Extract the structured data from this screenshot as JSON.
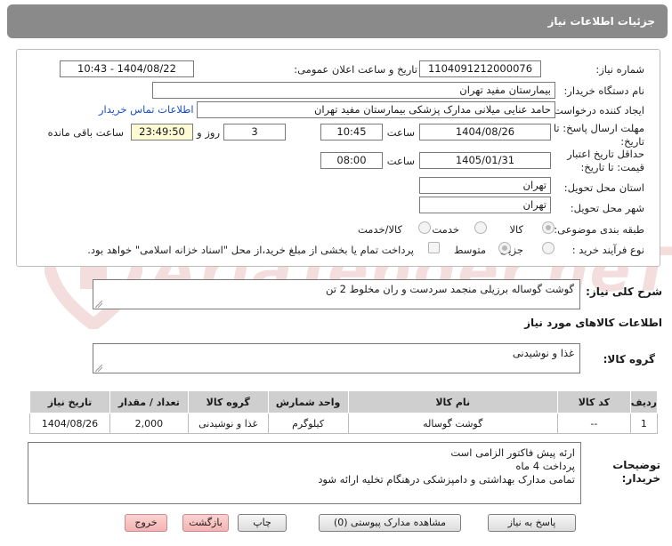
{
  "header": {
    "title": "جزئیات اطلاعات نیاز"
  },
  "form": {
    "need_number_label": "شماره نیاز:",
    "need_number": "1104091212000076",
    "announce_label": "تاریخ و ساعت اعلان عمومی:",
    "announce_value": "1404/08/22 - 10:43",
    "buyer_org_label": "نام دستگاه خریدار:",
    "buyer_org": "بیمارستان مفید تهران",
    "creator_label": "ایجاد کننده درخواست:",
    "creator": "حامد عنایی میلانی مدارک پزشکی بیمارستان مفید تهران",
    "contact_link": "اطلاعات تماس خریدار",
    "deadline_label_1": "مهلت ارسال پاسخ: تا",
    "deadline_label_2": "تاریخ:",
    "deadline_date": "1404/08/26",
    "time_label": "ساعت",
    "deadline_time": "10:45",
    "days_value": "3",
    "days_label": "روز و",
    "remaining_time": "23:49:50",
    "remaining_label": "ساعت باقی مانده",
    "validity_label_1": "حداقل تاریخ اعتبار",
    "validity_label_2": "قیمت: تا تاریخ:",
    "validity_date": "1405/01/31",
    "validity_time": "08:00",
    "province_label": "استان محل تحویل:",
    "province": "تهران",
    "city_label": "شهر محل تحویل:",
    "city": "تهران",
    "category_label": "طبقه بندی موضوعی:",
    "category_options": [
      "کالا",
      "خدمت",
      "کالا/خدمت"
    ],
    "purchase_type_label": "نوع فرآیند خرید :",
    "purchase_type_options": [
      "جزیی",
      "متوسط"
    ],
    "payment_note": "پرداخت تمام یا بخشی از مبلغ خرید،از محل \"اسناد خزانه اسلامی\" خواهد بود."
  },
  "need_desc": {
    "label": "شرح کلی نیاز:",
    "value": "گوشت گوساله  برزیلی منجمد سردست و ران مخلوط 2 تن"
  },
  "goods_info_title": "اطلاعات کالاهای مورد نیاز",
  "goods_group": {
    "label": "گروه کالا:",
    "value": "غذا و نوشیدنی"
  },
  "table": {
    "headers": [
      "ردیف",
      "کد کالا",
      "نام کالا",
      "واحد شمارش",
      "گروه کالا",
      "تعداد / مقدار",
      "تاریخ نیاز"
    ],
    "rows": [
      [
        "1",
        "--",
        "گوشت گوساله",
        "کیلوگرم",
        "غذا و نوشیدنی",
        "2,000",
        "1404/08/26"
      ]
    ]
  },
  "buyer_notes": {
    "label_1": "توضیحات",
    "label_2": "خریدار:",
    "lines": [
      "ارئه پیش فاکتور  الزامی است",
      "پرداخت 4 ماه",
      "تمامی مدارک بهداشتی و دامپزشکی  درهنگام تخلیه ارائه شود"
    ]
  },
  "buttons": {
    "reply": "پاسخ به نیاز",
    "view_docs": "مشاهده مدارک پیوستی (0)",
    "print": "چاپ",
    "back": "بازگشت",
    "exit": "خروج"
  },
  "watermark": {
    "text": "AriaTender.neT"
  },
  "colors": {
    "header_bg": "#8a8a8a",
    "link": "#1a4fc9",
    "highlight": "#fdfbd4",
    "exit_btn": "#f4b3b3"
  }
}
